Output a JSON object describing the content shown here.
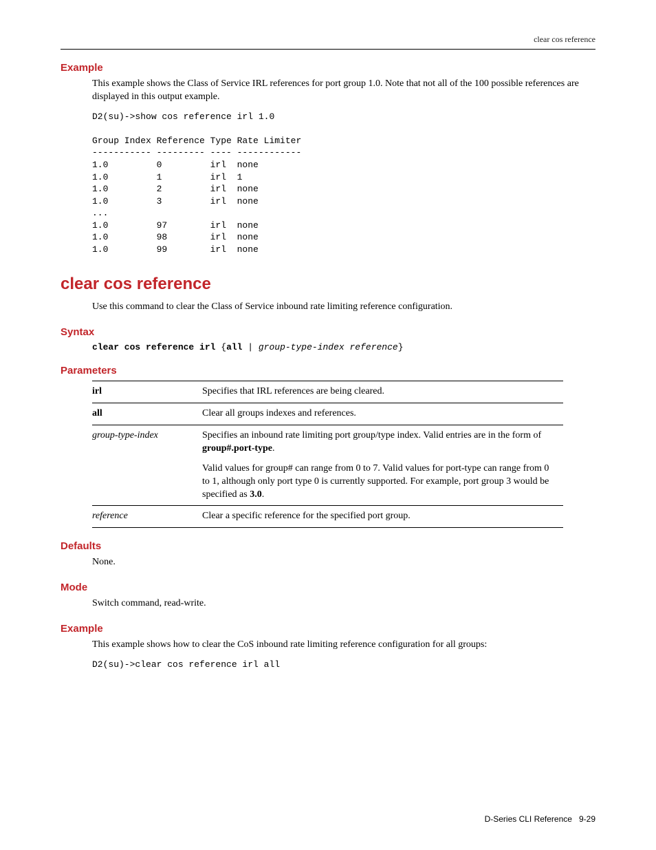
{
  "running_head": "clear cos reference",
  "sec1": {
    "example_h": "Example",
    "example_p": "This example shows the Class of Service IRL references for port group 1.0. Note that not all of the 100 possible references are displayed in this output example.",
    "cli": "D2(su)->show cos reference irl 1.0\n\nGroup Index Reference Type Rate Limiter\n----------- --------- ---- ------------\n1.0         0         irl  none\n1.0         1         irl  1\n1.0         2         irl  none\n1.0         3         irl  none\n...\n1.0         97        irl  none\n1.0         98        irl  none\n1.0         99        irl  none"
  },
  "title": "clear cos reference",
  "intro": "Use this command to clear the Class of Service inbound rate limiting reference configuration.",
  "syntax_h": "Syntax",
  "syntax_cmd": "clear cos reference irl",
  "syntax_brace_open": "{",
  "syntax_all": "all",
  "syntax_pipe": " | ",
  "syntax_args": "group-type-index reference",
  "syntax_brace_close": "}",
  "parameters_h": "Parameters",
  "params": {
    "irl_name": "irl",
    "irl_desc": "Specifies that IRL references are being cleared.",
    "all_name": "all",
    "all_desc": "Clear all groups indexes and references.",
    "gti_name": "group-type-index",
    "gti_desc1a": "Specifies an inbound rate limiting port group/type index. Valid entries are in the form of ",
    "gti_desc1b": "group#.port-type",
    "gti_desc1c": ".",
    "gti_desc2a": "Valid values for group# can range from 0 to 7. Valid values for port-type can range from 0 to 1, although only port type 0 is currently supported. For example, port group 3 would be specified as ",
    "gti_desc2b": "3.0",
    "gti_desc2c": ".",
    "ref_name": "reference",
    "ref_desc": "Clear a specific reference for the specified port group."
  },
  "defaults_h": "Defaults",
  "defaults_p": "None.",
  "mode_h": "Mode",
  "mode_p": "Switch command, read-write.",
  "example2_h": "Example",
  "example2_p": "This example shows how to clear the CoS inbound rate limiting reference configuration for all groups:",
  "example2_cli": "D2(su)->clear cos reference irl all",
  "footer_a": "D-Series CLI Reference",
  "footer_b": "9-29"
}
